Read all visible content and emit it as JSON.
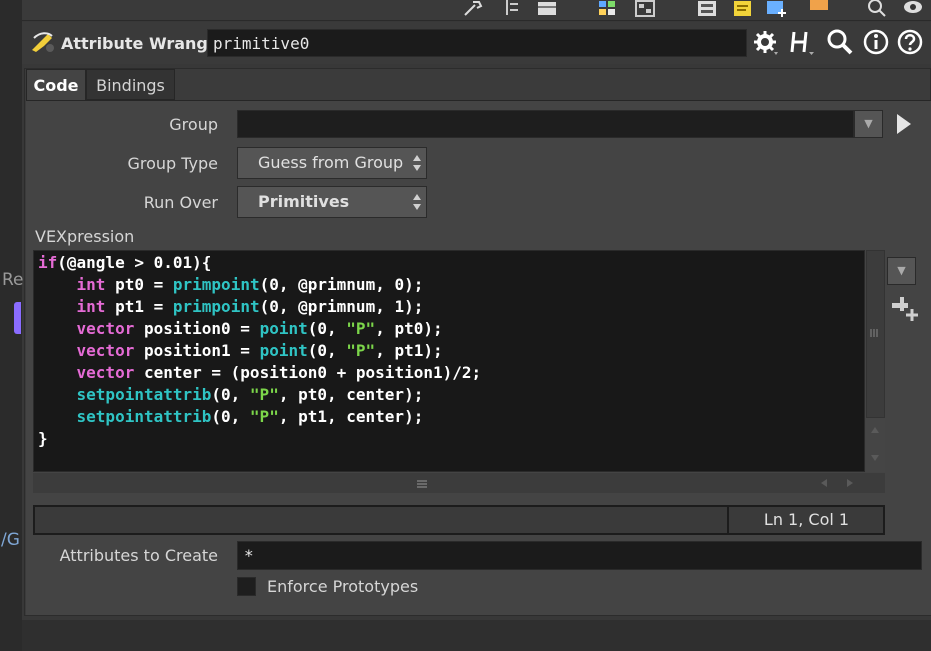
{
  "left_panel": {
    "partial_label_1": "Re",
    "partial_label_2": "/G"
  },
  "toolbar": {
    "icons": [
      "wrench-icon",
      "list-icon",
      "panel-icon",
      "grid-icon",
      "layout-icon",
      "network-icon",
      "note-icon",
      "image-add-icon",
      "box-icon",
      "search-icon",
      "eye-icon"
    ]
  },
  "header": {
    "node_type": "Attribute Wrangle",
    "node_name": "primitive0",
    "icons": [
      "gear-icon",
      "help-h-icon",
      "search-icon",
      "info-icon",
      "help-icon"
    ]
  },
  "tabs": [
    {
      "label": "Code",
      "active": true
    },
    {
      "label": "Bindings",
      "active": false
    }
  ],
  "params": {
    "group_label": "Group",
    "group_value": "",
    "group_type_label": "Group Type",
    "group_type_value": "Guess from Group",
    "run_over_label": "Run Over",
    "run_over_value": "Primitives",
    "vex_label": "VEXpression",
    "attrs_label": "Attributes to Create",
    "attrs_value": "*",
    "enforce_label": "Enforce Prototypes",
    "enforce_checked": false
  },
  "code_lines": [
    "if(@angle > 0.01){",
    "    int pt0 = primpoint(0, @primnum, 0);",
    "    int pt1 = primpoint(0, @primnum, 1);",
    "    vector position0 = point(0, \"P\", pt0);",
    "    vector position1 = point(0, \"P\", pt1);",
    "    vector center = (position0 + position1)/2;",
    "    setpointattrib(0, \"P\", pt0, center);",
    "    setpointattrib(0, \"P\", pt1, center);",
    "}"
  ],
  "status": {
    "cursor_position": "Ln 1, Col 1"
  },
  "colors": {
    "keyword": "#e56bd5",
    "function": "#2fc4c4",
    "string": "#7cd64a",
    "accent": "#8a6cff"
  }
}
